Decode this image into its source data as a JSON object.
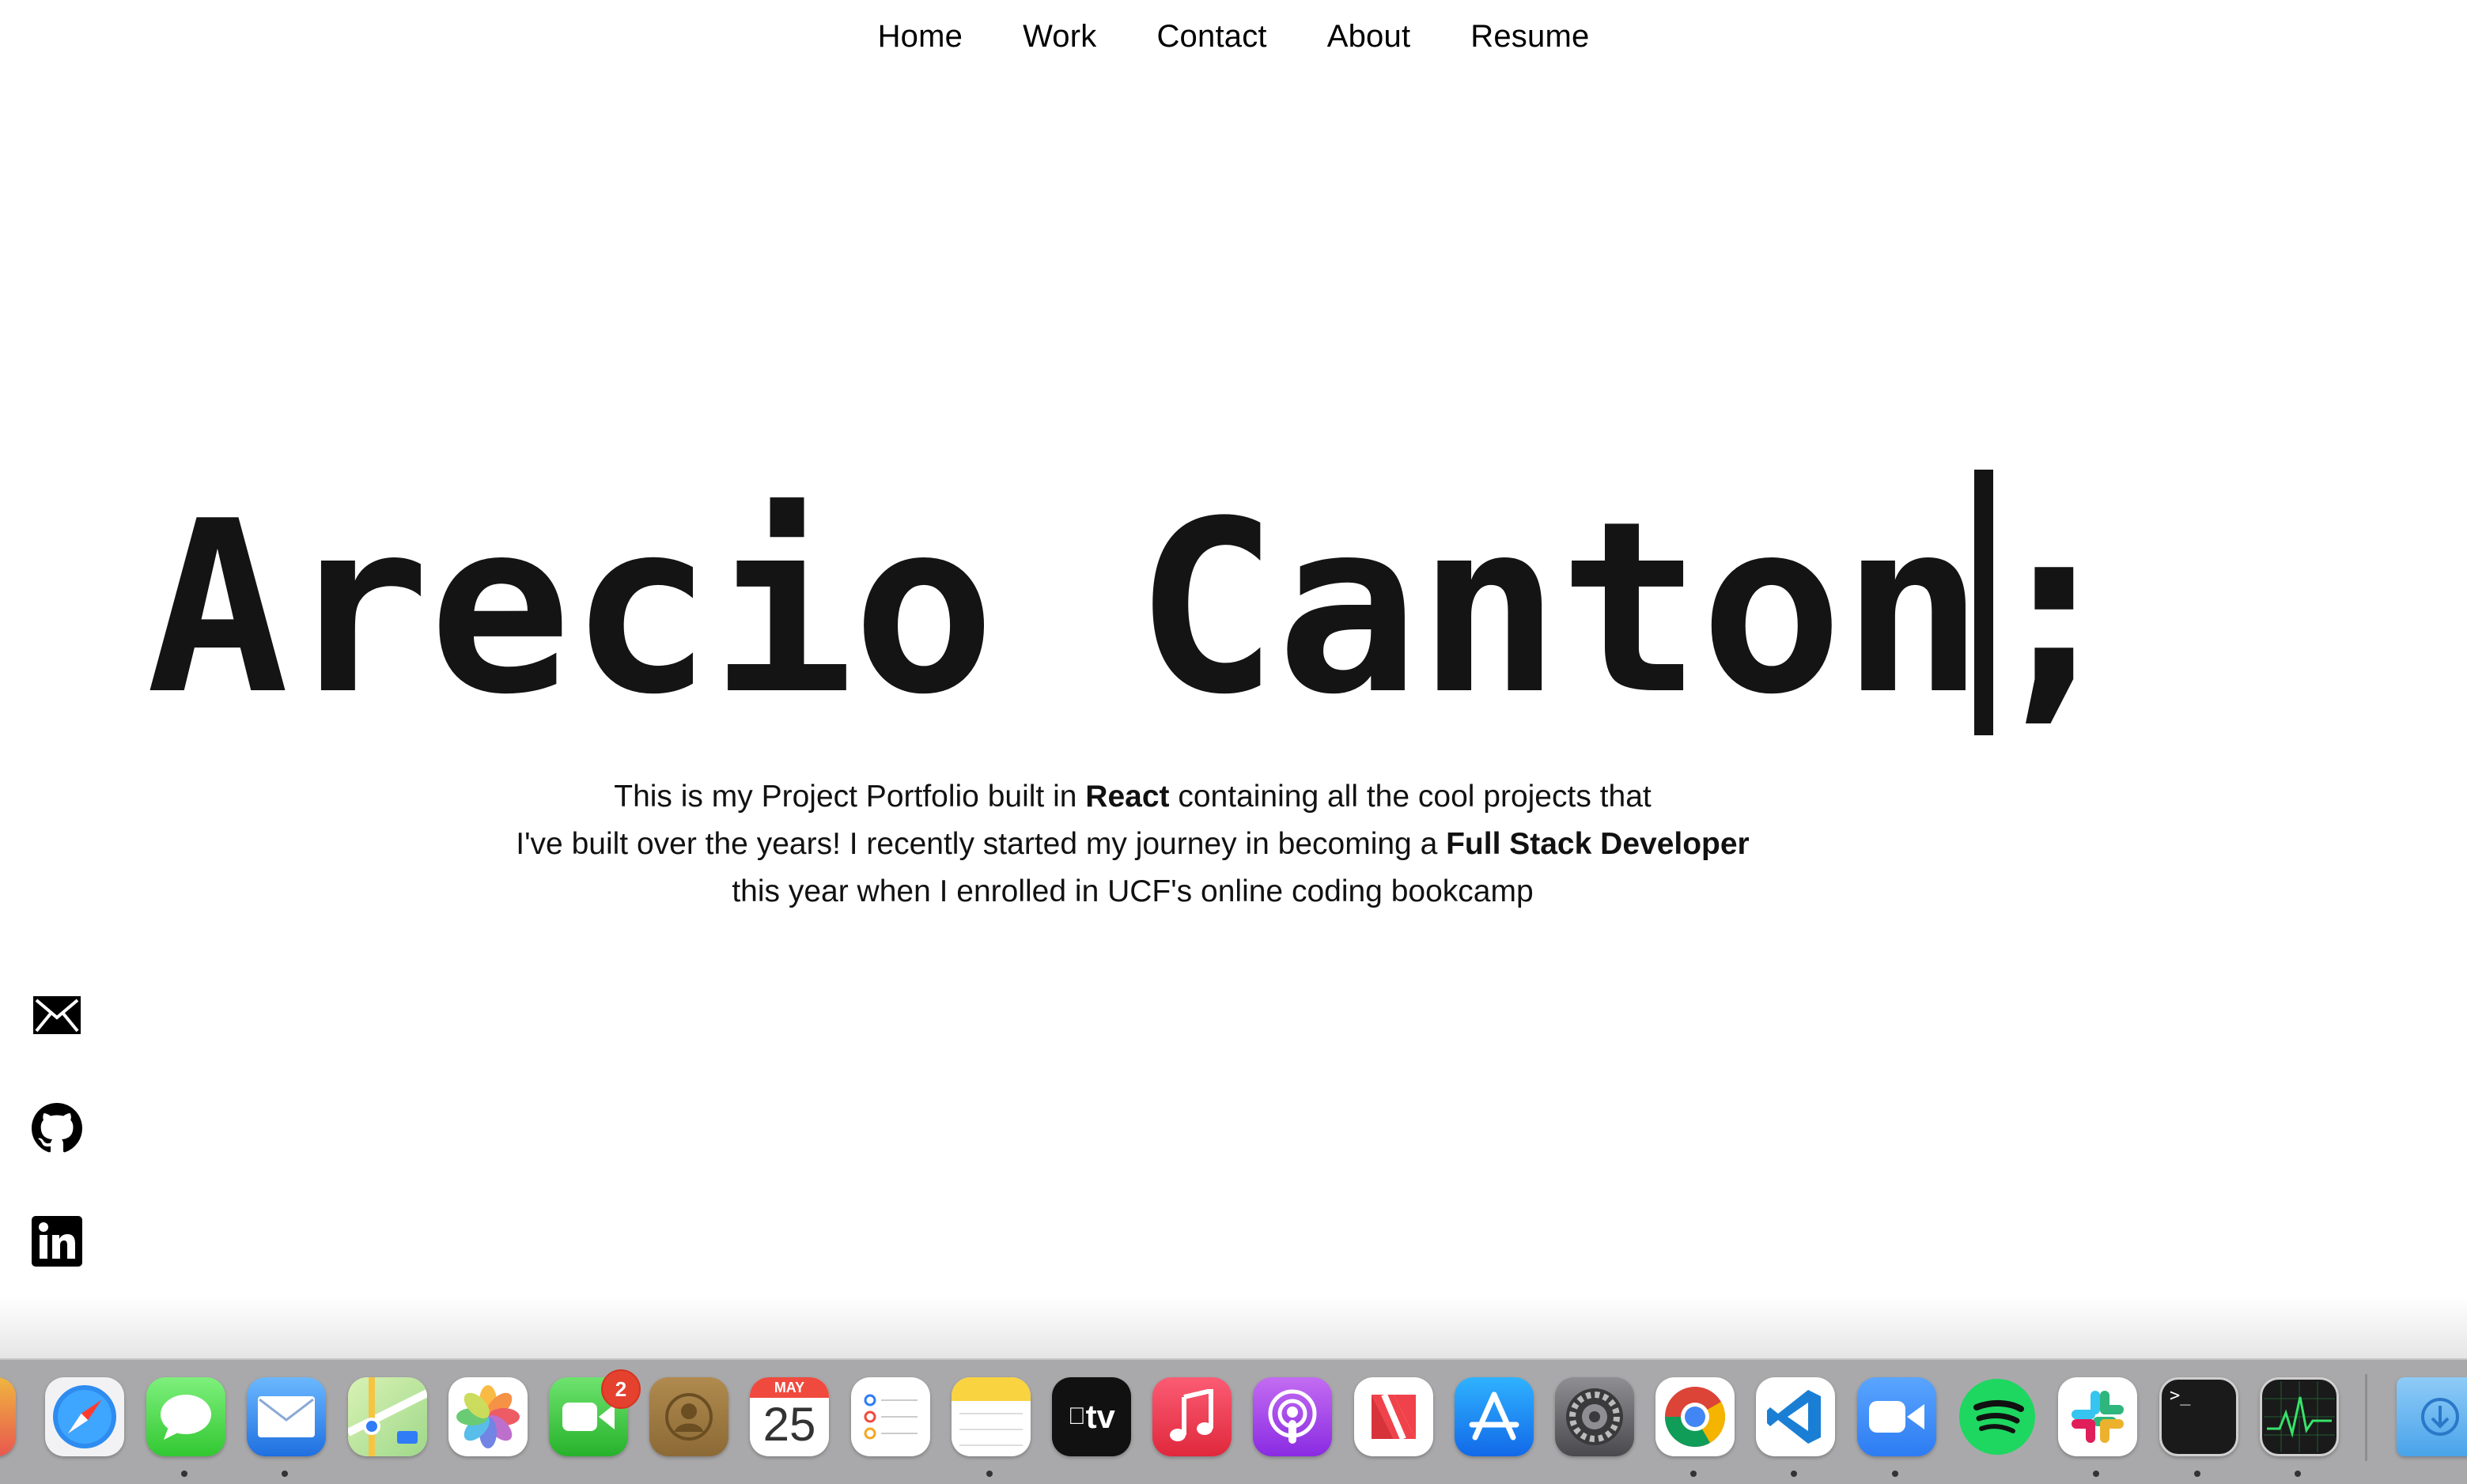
{
  "nav": {
    "items": [
      {
        "label": "Home"
      },
      {
        "label": "Work"
      },
      {
        "label": "Contact"
      },
      {
        "label": "About"
      },
      {
        "label": "Resume"
      }
    ]
  },
  "hero": {
    "title": "Arecio Canton;",
    "intro": {
      "line1_pre": "This is my Project Portfolio built in ",
      "line1_bold": "React",
      "line1_post": " containing all the cool projects that",
      "line2_pre": "I've built over the years! I recently started my journey in becoming a ",
      "line2_bold": "Full Stack Developer",
      "line3": "this year when I enrolled in UCF's online coding bookcamp"
    }
  },
  "social": [
    {
      "icon": "mail-icon"
    },
    {
      "icon": "github-icon"
    },
    {
      "icon": "linkedin-icon"
    }
  ],
  "dock": {
    "facetime_badge": "2",
    "calendar_month": "MAY",
    "calendar_day": "25",
    "tv_label": "tv",
    "apps": [
      "safari",
      "messages",
      "mail",
      "maps",
      "photos",
      "facetime",
      "contacts",
      "calendar",
      "reminders",
      "notes",
      "apple-tv",
      "music",
      "podcasts",
      "news",
      "app-store",
      "system-preferences",
      "chrome",
      "vscode",
      "zoom",
      "spotify",
      "slack",
      "terminal",
      "activity-monitor",
      "downloads"
    ]
  },
  "colors": {
    "text": "#141414",
    "dock_bg": "#a9a9ab",
    "badge": "#e4412f"
  }
}
